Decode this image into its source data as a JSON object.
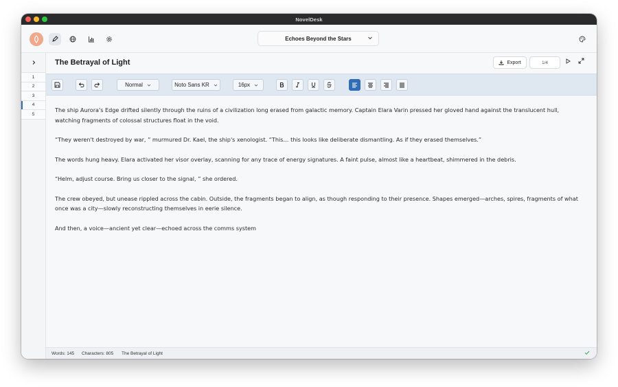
{
  "window": {
    "title": "NovelDesk"
  },
  "header": {
    "project_title": "Echoes Beyond the Stars"
  },
  "sidebar": {
    "items": [
      "1",
      "2",
      "3",
      "4",
      "5"
    ],
    "active_index": 3
  },
  "document": {
    "title": "The Betrayal of Light",
    "export_label": "Export",
    "page_indicator": "1/4"
  },
  "toolbar": {
    "style": "Normal",
    "font": "Noto Sans KR",
    "size": "16px"
  },
  "content": {
    "paragraphs": [
      "The ship Aurora's Edge drifted silently through the ruins of a civilization long erased from galactic memory. Captain Elara Varin pressed her gloved hand against the translucent hull, watching fragments of colossal structures float in the void.",
      "“They weren't destroyed by war, ” murmured Dr. Kael, the ship's xenologist. “This… this looks like deliberate dismantling. As if they erased themselves.”",
      "The words hung heavy. Elara activated her visor overlay, scanning for any trace of energy signatures. A faint pulse, almost like a heartbeat, shimmered in the debris.",
      "“Helm, adjust course. Bring us closer to the signal, ” she ordered.",
      "The crew obeyed, but unease rippled across the cabin. Outside, the fragments began to align, as though responding to their presence. Shapes emerged—arches, spires, fragments of what once was a city—slowly reconstructing themselves in eerie silence.",
      "And then, a voice—ancient yet clear—echoed across the comms system"
    ]
  },
  "status": {
    "words": "Words: 145",
    "characters": "Characters: 805",
    "doc": "The Betrayal of Light"
  },
  "colors": {
    "accent": "#2f6db5",
    "toolbar_bg": "#dfe7f1",
    "logo": "#f2a88a",
    "ok": "#2ea44f"
  }
}
